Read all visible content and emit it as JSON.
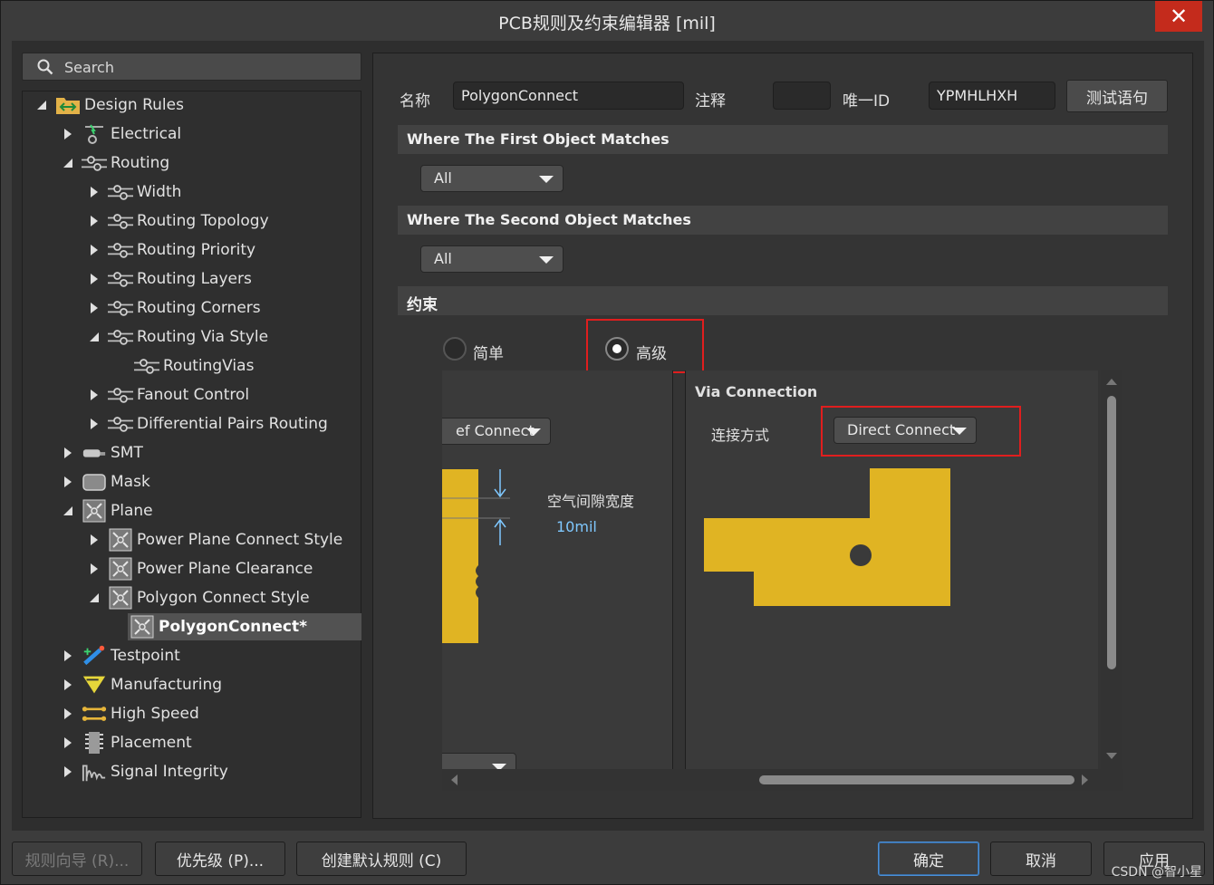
{
  "window": {
    "title": "PCB规则及约束编辑器 [mil]",
    "close_glyph": "✕"
  },
  "search": {
    "placeholder": "Search"
  },
  "tree": [
    {
      "label": "Design Rules",
      "icon": "design-rules-folder-icon",
      "expanded": true
    },
    {
      "label": "Electrical",
      "icon": "electrical-icon",
      "expanded": false
    },
    {
      "label": "Routing",
      "icon": "routing-icon",
      "expanded": true
    },
    {
      "label": "Width",
      "icon": "routing-icon",
      "expanded": false
    },
    {
      "label": "Routing Topology",
      "icon": "routing-icon",
      "expanded": false
    },
    {
      "label": "Routing Priority",
      "icon": "routing-icon",
      "expanded": false
    },
    {
      "label": "Routing Layers",
      "icon": "routing-icon",
      "expanded": false
    },
    {
      "label": "Routing Corners",
      "icon": "routing-icon",
      "expanded": false
    },
    {
      "label": "Routing Via Style",
      "icon": "routing-icon",
      "expanded": true
    },
    {
      "label": "RoutingVias",
      "icon": "routing-icon"
    },
    {
      "label": "Fanout Control",
      "icon": "routing-icon",
      "expanded": false
    },
    {
      "label": "Differential Pairs Routing",
      "icon": "routing-icon",
      "expanded": false
    },
    {
      "label": "SMT",
      "icon": "smt-icon",
      "expanded": false
    },
    {
      "label": "Mask",
      "icon": "mask-icon",
      "expanded": false
    },
    {
      "label": "Plane",
      "icon": "plane-icon",
      "expanded": true
    },
    {
      "label": "Power Plane Connect Style",
      "icon": "plane-icon",
      "expanded": false
    },
    {
      "label": "Power Plane Clearance",
      "icon": "plane-icon",
      "expanded": false
    },
    {
      "label": "Polygon Connect Style",
      "icon": "plane-icon",
      "expanded": true
    },
    {
      "label": "PolygonConnect*",
      "icon": "plane-icon",
      "selected": true
    },
    {
      "label": "Testpoint",
      "icon": "testpoint-icon",
      "expanded": false
    },
    {
      "label": "Manufacturing",
      "icon": "manufacturing-icon",
      "expanded": false
    },
    {
      "label": "High Speed",
      "icon": "high-speed-icon",
      "expanded": false
    },
    {
      "label": "Placement",
      "icon": "placement-icon",
      "expanded": false
    },
    {
      "label": "Signal Integrity",
      "icon": "signal-integrity-icon",
      "expanded": false
    }
  ],
  "rule": {
    "name_label": "名称",
    "name_value": "PolygonConnect",
    "comment_label": "注释",
    "comment_value": "",
    "uid_label": "唯一ID",
    "uid_value": "YPMHLHXH",
    "test_button": "测试语句"
  },
  "first_match": {
    "title": "Where The First Object Matches",
    "value": "All"
  },
  "second_match": {
    "title": "Where The Second Object Matches",
    "value": "All"
  },
  "constraints": {
    "title": "约束",
    "simple_label": "简单",
    "advanced_label": "高级",
    "left_dropdown": "ef Connect",
    "air_gap_label": "空气间隙宽度",
    "air_gap_value": "10mil",
    "via_title": "Via Connection",
    "connect_label": "连接方式",
    "connect_value": "Direct Connect"
  },
  "buttons": {
    "wizard": "规则向导 (R)...",
    "priority": "优先级 (P)...",
    "create_default": "创建默认规则 (C)",
    "ok": "确定",
    "cancel": "取消",
    "apply": "应用"
  },
  "watermark": "CSDN @智小星",
  "colors": {
    "copper": "#e0b423",
    "highlight": "#e01e1e",
    "accent_blue": "#7fc8ff"
  }
}
